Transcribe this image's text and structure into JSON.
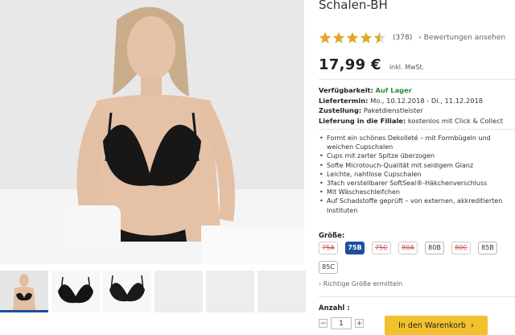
{
  "product": {
    "title": "Schalen-BH",
    "rating_count": "(378)",
    "rating_link": "Bewertungen ansehen",
    "rating_stars": 4.5,
    "price": "17,99 €",
    "vat_note": "inkl. MwSt.",
    "info": {
      "availability_label": "Verfügbarkeit:",
      "availability_value": "Auf Lager",
      "delivery_label": "Liefertermin:",
      "delivery_value": "Mo., 10.12.2018 - Di., 11.12.2018",
      "shipping_label": "Zustellung:",
      "shipping_value": "Paketdienstleister",
      "store_label": "Lieferung in die Filiale:",
      "store_value": "kostenlos mit Click & Collect"
    },
    "features": [
      "Formt ein schönes Dekolleté – mit Formbügeln und weichen Cupschalen",
      "Cups mit zarter Spitze überzogen",
      "Softe Microtouch-Qualität mit seidigem Glanz",
      "Leichte, nahtlose Cupschalen",
      "3fach verstellbarer SoftSeal®-Häkchenverschluss",
      "Mit Wäscheschleifchen",
      "Auf Schadstoffe geprüft – von externen, akkreditierten Instituten"
    ],
    "size_label": "Größe:",
    "sizes": [
      {
        "label": "75A",
        "state": "unavailable"
      },
      {
        "label": "75B",
        "state": "selected"
      },
      {
        "label": "75C",
        "state": "unavailable"
      },
      {
        "label": "80A",
        "state": "unavailable"
      },
      {
        "label": "80B",
        "state": "available"
      },
      {
        "label": "80C",
        "state": "unavailable"
      },
      {
        "label": "85B",
        "state": "available"
      },
      {
        "label": "85C",
        "state": "available"
      }
    ],
    "fit_link": "Richtige Größe ermitteln",
    "qty_label": "Anzahl :",
    "qty_value": "1",
    "qty_minus": "−",
    "qty_plus": "+",
    "cart_label": "In den Warenkorb",
    "cart_arrow": "›"
  },
  "colors": {
    "accent_blue": "#1b4f9c",
    "cart_yellow": "#f2c12e",
    "star_gold": "#e0a823",
    "stock_green": "#2e8b3b"
  }
}
